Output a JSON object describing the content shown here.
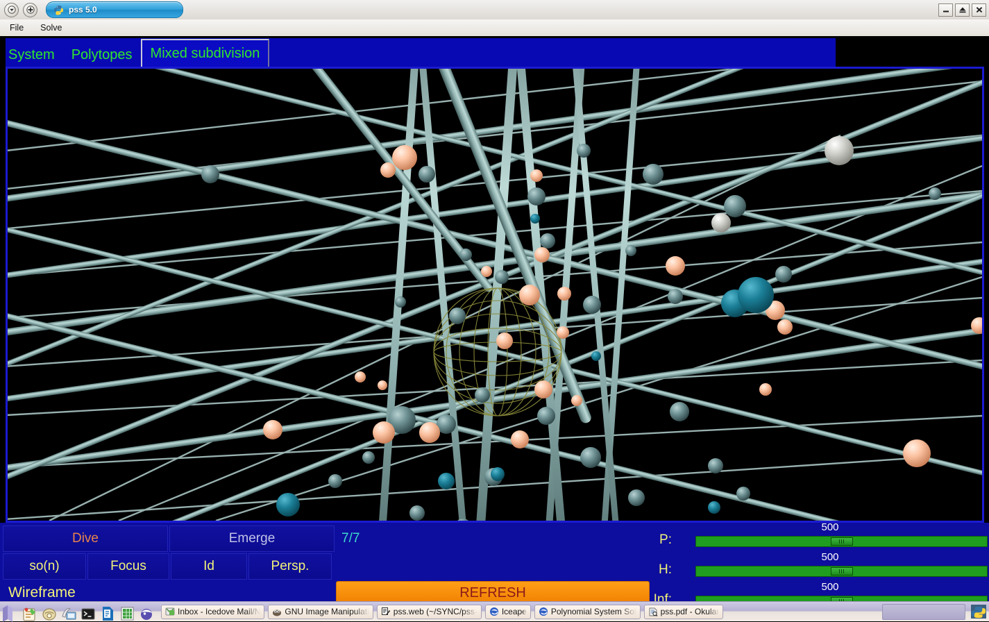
{
  "window": {
    "title": "pss 5.0",
    "icon": "python-icon",
    "shade_button": "chevron-down-icon",
    "stick_button": "plus-icon",
    "minimize": "minimize-icon",
    "maximize": "maximize-icon",
    "close": "close-icon"
  },
  "menubar": {
    "items": [
      {
        "label": "File"
      },
      {
        "label": "Solve"
      }
    ]
  },
  "tabs": [
    {
      "label": "System",
      "selected": false
    },
    {
      "label": "Polytopes",
      "selected": false
    },
    {
      "label": "Mixed subdivision",
      "selected": true
    }
  ],
  "viewport": {
    "background": "#000000",
    "border_color": "#1a1ad0",
    "rod_color": "#9fc4c2",
    "node_color": "#5f8487",
    "highlight_color": "#f7c2a4",
    "accent_node_color": "#16788f",
    "wire_sphere_color": "#8a8a3a"
  },
  "controls": {
    "dive": "Dive",
    "emerge": "Emerge",
    "counter": "7/7",
    "son": "so(n)",
    "focus": "Focus",
    "id": "Id",
    "persp": "Persp.",
    "wireframe": "Wireframe",
    "refresh": "REFRESH",
    "colors": {
      "panel_bg": "#0d0d9e",
      "dive_text": "#e8834c",
      "emerge_text": "#c2c2e8",
      "counter_text": "#3ddccb",
      "button_text": "#f2f27a",
      "refresh_bg": "#f08000",
      "refresh_text": "#8c1a1a"
    }
  },
  "sliders": [
    {
      "label": "P:",
      "value": "500",
      "percent": 50
    },
    {
      "label": "H:",
      "value": "500",
      "percent": 50
    },
    {
      "label": "Inf:",
      "value": "500",
      "percent": 50
    }
  ],
  "taskbar": {
    "tray_icons": [
      "notes-icon",
      "clipboard-icon",
      "kontact-icon",
      "terminal-icon",
      "document-icon",
      "spreadsheet-icon",
      "browser-icon"
    ],
    "tasks": [
      {
        "label": "Inbox - Icedove Mail/N",
        "icon": "icedove-icon"
      },
      {
        "label": "GNU Image Manipulati",
        "icon": "gimp-icon"
      },
      {
        "label": "pss.web (~/SYNC/pss-",
        "icon": "editor-icon"
      },
      {
        "label": "Iceape",
        "icon": "iceape-icon"
      },
      {
        "label": "Polynomial System Sol",
        "icon": "iceape-icon"
      },
      {
        "label": "pss.pdf - Okular",
        "icon": "okular-icon"
      }
    ],
    "pager_icon": "pager-icon",
    "right_icon": "python-tray-icon"
  }
}
